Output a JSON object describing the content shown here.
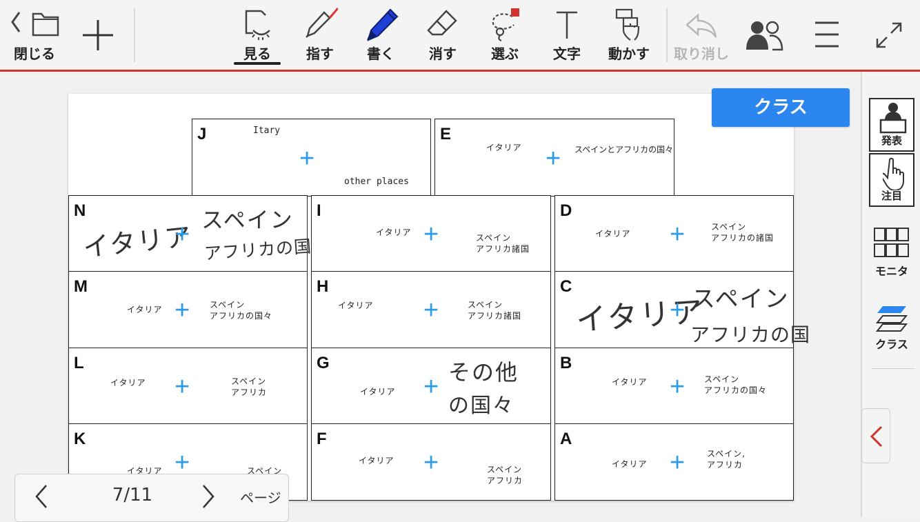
{
  "toolbar": {
    "close_label": "閉じる",
    "tools": [
      {
        "label": "見る",
        "icon": "view-icon",
        "selected": true
      },
      {
        "label": "指す",
        "icon": "laser-pointer-icon"
      },
      {
        "label": "書く",
        "icon": "pen-icon"
      },
      {
        "label": "消す",
        "icon": "eraser-icon"
      },
      {
        "label": "選ぶ",
        "icon": "lasso-select-icon"
      },
      {
        "label": "文字",
        "icon": "text-icon"
      },
      {
        "label": "動かす",
        "icon": "move-hand-icon"
      }
    ],
    "undo_label": "取り消し",
    "accent_color": "#d0342c",
    "pen_color": "#1f3fd6"
  },
  "class_button_label": "クラス",
  "sidebar": {
    "present_label": "発表",
    "attention_label": "注目",
    "monitor_label": "モニタ",
    "class_label": "クラス"
  },
  "pagenav": {
    "page_indicator": "7/11",
    "page_label": "ページ"
  },
  "cards": {
    "J": {
      "letter": "J",
      "t1": "Itary",
      "t2": "other places"
    },
    "E": {
      "letter": "E",
      "t1": "イタリア",
      "t2": "スペインとアフリカの国々"
    },
    "N": {
      "letter": "N",
      "h1": "イタリア",
      "h2": "スペイン",
      "h3": "アフリカの国々"
    },
    "I": {
      "letter": "I",
      "t1": "イタリア",
      "t2": "スペイン\nアフリカ諸国"
    },
    "D": {
      "letter": "D",
      "t1": "イタリア",
      "t2": "スペイン\nアフリカの諸国"
    },
    "M": {
      "letter": "M",
      "t1": "イタリア",
      "t2": "スペイン\nアフリカの国々"
    },
    "H": {
      "letter": "H",
      "t1": "イタリア",
      "t2": "スペイン\nアフリカ諸国"
    },
    "C": {
      "letter": "C",
      "h1": "イタリア",
      "h2": "スペイン",
      "h3": "アフリカの国"
    },
    "L": {
      "letter": "L",
      "t1": "イタリア",
      "t2": "スペイン\nアフリカ"
    },
    "G": {
      "letter": "G",
      "t1": "イタリア",
      "h1": "その他",
      "h2": "の国々"
    },
    "B": {
      "letter": "B",
      "t1": "イタリア",
      "t2": "スペイン\nアフリカの国々"
    },
    "K": {
      "letter": "K",
      "t1": "イタリア",
      "t2": "スペイン"
    },
    "F": {
      "letter": "F",
      "t1": "イタリア",
      "t2": "スペイン\nアフリカ"
    },
    "A": {
      "letter": "A",
      "t1": "イタリア",
      "t2": "スペイン,\nアフリカ"
    }
  }
}
